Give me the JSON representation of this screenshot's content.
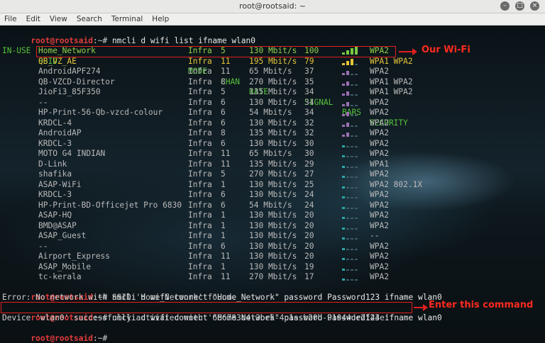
{
  "window": {
    "title": "root@rootsaid: ~"
  },
  "menu": [
    "File",
    "Edit",
    "View",
    "Search",
    "Terminal",
    "Help"
  ],
  "prompt": {
    "user": "root@rootsaid",
    "sep": ":~# "
  },
  "commands": {
    "list": "nmcli d wifi list ifname wlan0",
    "connect_fail": "nmcli d wifi connect \"Home_Network\" password Password123 ifname wlan0",
    "connect_ok": "nmcli d wifi connect \"Home Network\" password Password123 ifname wlan0"
  },
  "headers": {
    "inuse": "IN-USE",
    "ssid": "SSID",
    "mode": "MODE",
    "chan": "CHAN",
    "rate": "RATE",
    "signal": "SIGNAL",
    "bars": "BARS",
    "security": "SECURITY"
  },
  "networks": [
    {
      "ssid": "Home_Network",
      "mode": "Infra",
      "chan": "5",
      "rate": "130 Mbit/s",
      "signal": "100",
      "bars": 4,
      "security": "WPA2"
    },
    {
      "ssid": "QB_VZ_AE",
      "mode": "Infra",
      "chan": "11",
      "rate": "195 Mbit/s",
      "signal": "79",
      "bars": 3,
      "security": "WPA1 WPA2"
    },
    {
      "ssid": "AndroidAPF274",
      "mode": "Infra",
      "chan": "11",
      "rate": "65 Mbit/s",
      "signal": "37",
      "bars": 2,
      "security": "WPA2"
    },
    {
      "ssid": "QB-VZCD-Director",
      "mode": "Infra",
      "chan": "8",
      "rate": "270 Mbit/s",
      "signal": "35",
      "bars": 2,
      "security": "WPA1 WPA2"
    },
    {
      "ssid": "JioFi3_85F350",
      "mode": "Infra",
      "chan": "5",
      "rate": "135 Mbit/s",
      "signal": "34",
      "bars": 2,
      "security": "WPA1 WPA2"
    },
    {
      "ssid": "--",
      "mode": "Infra",
      "chan": "6",
      "rate": "130 Mbit/s",
      "signal": "34",
      "bars": 2,
      "security": "WPA2"
    },
    {
      "ssid": "HP-Print-56-Qb-vzcd-colour",
      "mode": "Infra",
      "chan": "6",
      "rate": "54 Mbit/s",
      "signal": "34",
      "bars": 2,
      "security": "WPA2"
    },
    {
      "ssid": "KRDCL-4",
      "mode": "Infra",
      "chan": "6",
      "rate": "130 Mbit/s",
      "signal": "32",
      "bars": 2,
      "security": "WPA2"
    },
    {
      "ssid": "AndroidAP",
      "mode": "Infra",
      "chan": "8",
      "rate": "135 Mbit/s",
      "signal": "32",
      "bars": 2,
      "security": "WPA2"
    },
    {
      "ssid": "KRDCL-3",
      "mode": "Infra",
      "chan": "6",
      "rate": "130 Mbit/s",
      "signal": "30",
      "bars": 1,
      "security": "WPA2"
    },
    {
      "ssid": "MOTO G4 INDIAN",
      "mode": "Infra",
      "chan": "11",
      "rate": "65 Mbit/s",
      "signal": "30",
      "bars": 1,
      "security": "WPA2"
    },
    {
      "ssid": "D-Link",
      "mode": "Infra",
      "chan": "11",
      "rate": "135 Mbit/s",
      "signal": "29",
      "bars": 1,
      "security": "WPA1"
    },
    {
      "ssid": "shafika",
      "mode": "Infra",
      "chan": "5",
      "rate": "270 Mbit/s",
      "signal": "27",
      "bars": 1,
      "security": "WPA2"
    },
    {
      "ssid": "ASAP-WiFi",
      "mode": "Infra",
      "chan": "1",
      "rate": "130 Mbit/s",
      "signal": "25",
      "bars": 1,
      "security": "WPA2 802.1X"
    },
    {
      "ssid": "KRDCL-3",
      "mode": "Infra",
      "chan": "6",
      "rate": "130 Mbit/s",
      "signal": "24",
      "bars": 1,
      "security": "WPA2"
    },
    {
      "ssid": "HP-Print-BD-Officejet Pro 6830",
      "mode": "Infra",
      "chan": "6",
      "rate": "54 Mbit/s",
      "signal": "24",
      "bars": 1,
      "security": "WPA2"
    },
    {
      "ssid": "ASAP-HQ",
      "mode": "Infra",
      "chan": "1",
      "rate": "130 Mbit/s",
      "signal": "20",
      "bars": 1,
      "security": "WPA2"
    },
    {
      "ssid": "BMD@ASAP",
      "mode": "Infra",
      "chan": "1",
      "rate": "130 Mbit/s",
      "signal": "20",
      "bars": 1,
      "security": "WPA2"
    },
    {
      "ssid": "ASAP_Guest",
      "mode": "Infra",
      "chan": "1",
      "rate": "130 Mbit/s",
      "signal": "20",
      "bars": 1,
      "security": "--"
    },
    {
      "ssid": "--",
      "mode": "Infra",
      "chan": "6",
      "rate": "130 Mbit/s",
      "signal": "20",
      "bars": 1,
      "security": "WPA2"
    },
    {
      "ssid": "Airport_Express",
      "mode": "Infra",
      "chan": "11",
      "rate": "130 Mbit/s",
      "signal": "20",
      "bars": 1,
      "security": "WPA2"
    },
    {
      "ssid": "ASAP_Mobile",
      "mode": "Infra",
      "chan": "1",
      "rate": "130 Mbit/s",
      "signal": "19",
      "bars": 1,
      "security": "WPA2"
    },
    {
      "ssid": "tc-kerala",
      "mode": "Infra",
      "chan": "11",
      "rate": "270 Mbit/s",
      "signal": "17",
      "bars": 1,
      "security": "WPA2"
    }
  ],
  "messages": {
    "error": "Error: No network with SSID 'Home_Network' found.",
    "success": "Device 'wlan0' successfully activated with '666783c4-3be5-4c1a-b20b-91044de2f44e'."
  },
  "annotations": {
    "our_wifi": "Our Wi-Fi",
    "enter_cmd": "Enter this command"
  },
  "colors": {
    "prompt": "#e23b3b",
    "header": "#56c23c",
    "annotation": "#ff2a1f",
    "bars_green": "#7ac943",
    "bars_yellow": "#e6c43a",
    "bars_purple": "#9b6fb3",
    "bars_teal": "#2aa8a8"
  }
}
